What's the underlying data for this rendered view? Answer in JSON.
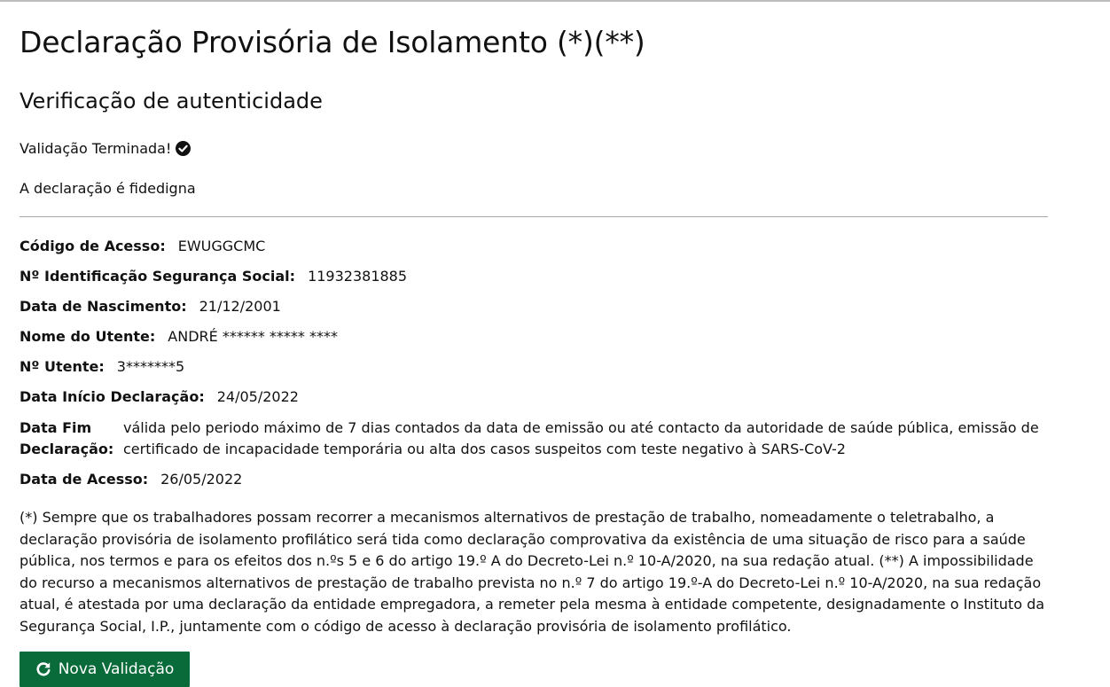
{
  "page": {
    "title": "Declaração Provisória de Isolamento (*)(**)",
    "subtitle": "Verificação de autenticidade",
    "status_text": "Validação Terminada!",
    "status_icon": "check-circle-icon",
    "result_text": "A declaração é fidedigna"
  },
  "fields": {
    "codigo": {
      "label": "Código de Acesso:",
      "value": "EWUGGCMC"
    },
    "niss": {
      "label": "Nº Identificação Segurança Social:",
      "value": "11932381885"
    },
    "nascimento": {
      "label": "Data de Nascimento:",
      "value": "21/12/2001"
    },
    "nome": {
      "label": "Nome do Utente:",
      "value": "ANDRÉ ****** ***** ****"
    },
    "utente": {
      "label": "Nº Utente:",
      "value": "3*******5"
    },
    "inicio": {
      "label": "Data Início Declaração:",
      "value": "24/05/2022"
    },
    "fim": {
      "label": "Data Fim Declaração:",
      "value": "válida pelo periodo máximo de 7 dias contados da data de emissão ou até contacto da autoridade de saúde pública, emissão de certificado de incapacidade temporária ou alta dos casos suspeitos com teste negativo à SARS-CoV-2"
    },
    "acesso": {
      "label": "Data de Acesso:",
      "value": "26/05/2022"
    }
  },
  "note": "(*) Sempre que os trabalhadores possam recorrer a mecanismos alternativos de prestação de trabalho, nomeadamente o teletrabalho, a declaração provisória de isolamento profilático será tida como declaração comprovativa da existência de uma situação de risco para a saúde pública, nos termos e para os efeitos dos n.ºs 5 e 6 do artigo 19.º A do Decreto-Lei n.º 10-A/2020, na sua redação atual. (**) A impossibilidade do recurso a mecanismos alternativos de prestação de trabalho prevista no n.º 7 do artigo 19.º-A do Decreto-Lei n.º 10-A/2020, na sua redação atual, é atestada por uma declaração da entidade empregadora, a remeter pela mesma à entidade competente, designadamente o Instituto da Segurança Social, I.P., juntamente com o código de acesso à declaração provisória de isolamento profilático.",
  "button": {
    "label": "Nova Validação",
    "icon": "refresh-icon",
    "color": "#0a6b3a"
  }
}
